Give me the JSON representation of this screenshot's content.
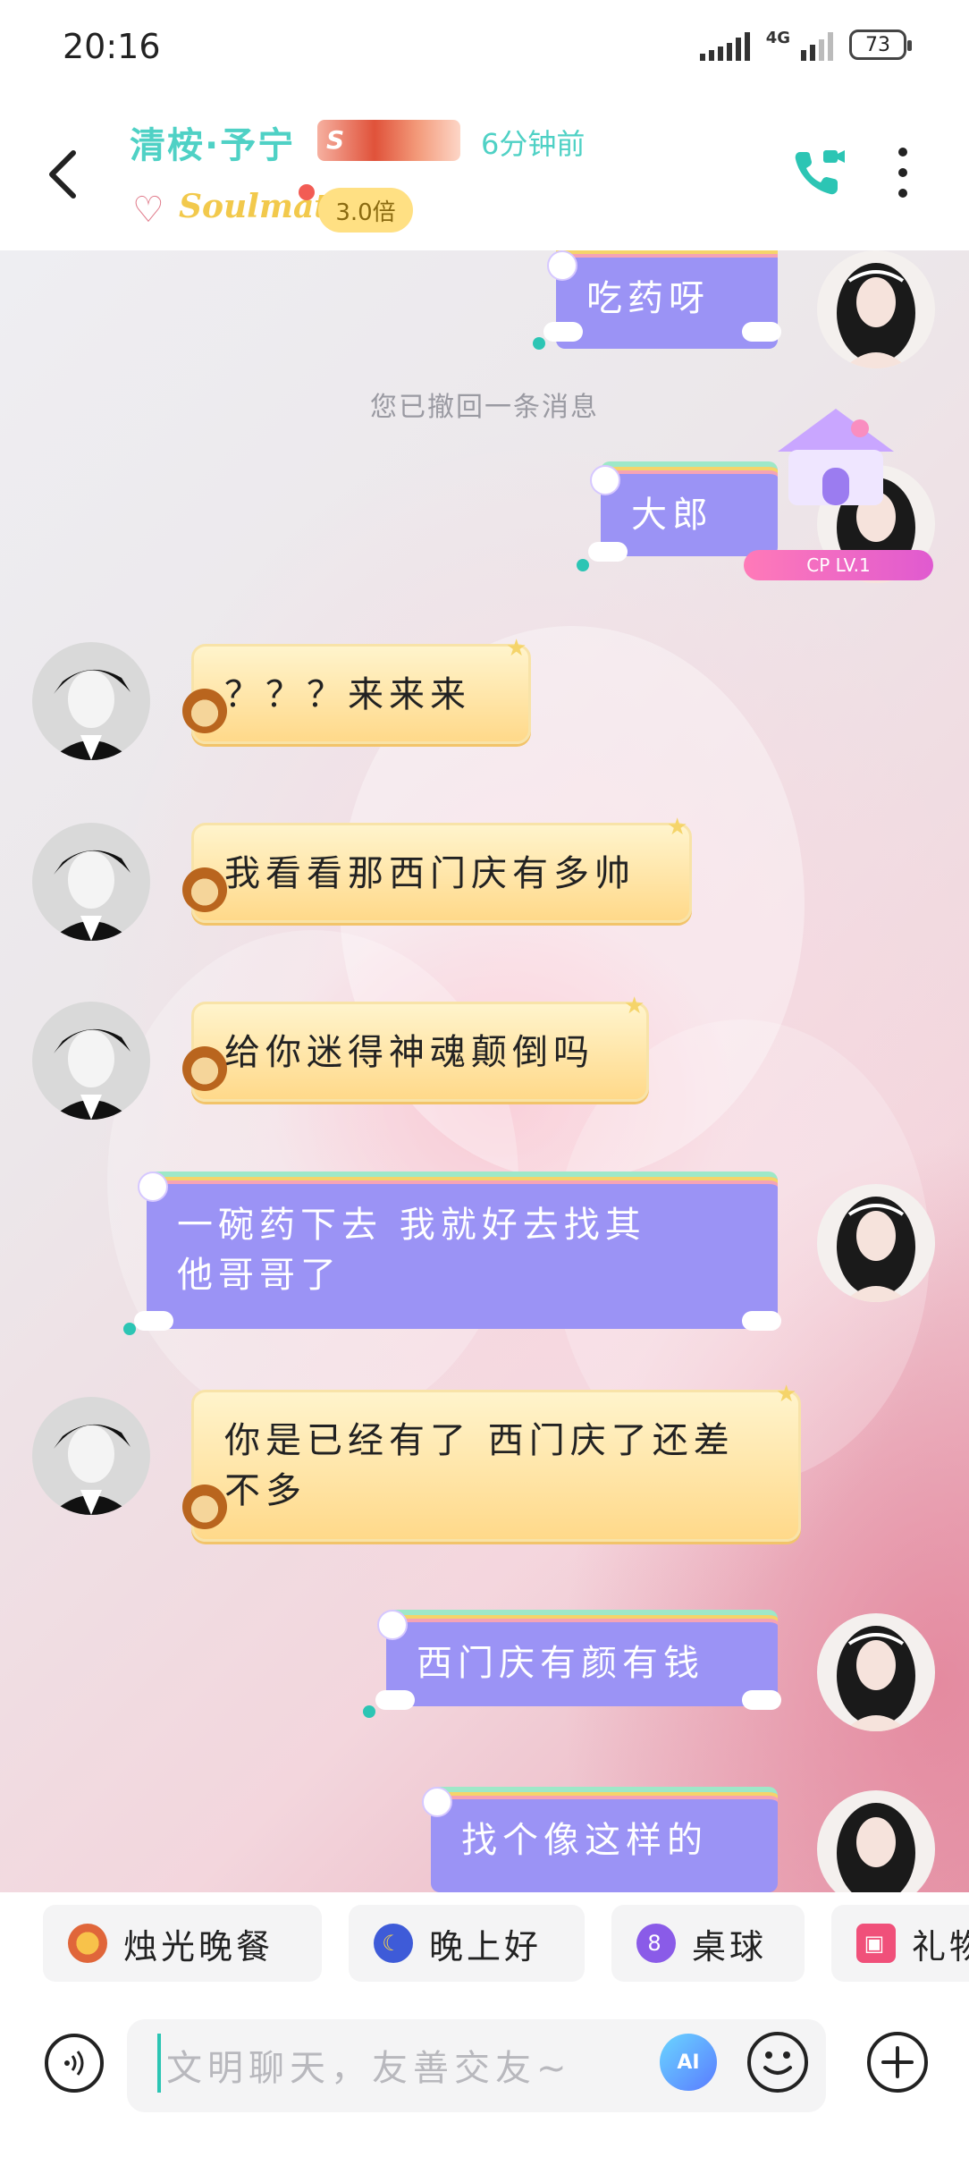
{
  "status_bar": {
    "time": "20:16",
    "network": "4G",
    "battery": "73"
  },
  "header": {
    "contact_name": "清桉·予宁",
    "last_seen": "6分钟前",
    "relationship": "Soulmate",
    "multiplier": "3.0倍"
  },
  "system_message": "您已撤回一条消息",
  "cp_level": "CP LV.1",
  "messages": [
    {
      "side": "me",
      "text": "吃药呀"
    },
    {
      "side": "me",
      "text": "大郎"
    },
    {
      "side": "them",
      "text": "？？？来来来"
    },
    {
      "side": "them",
      "text": "我看看那西门庆有多帅"
    },
    {
      "side": "them",
      "text": "给你迷得神魂颠倒吗"
    },
    {
      "side": "me",
      "line1": "一碗药下去  我就好去找其",
      "line2": "他哥哥了"
    },
    {
      "side": "them",
      "line1": "你是已经有了 西门庆了还差",
      "line2": "不多"
    },
    {
      "side": "me",
      "text": "西门庆有颜有钱"
    },
    {
      "side": "me",
      "text": "找个像这样的"
    }
  ],
  "quick_chips": [
    {
      "label": "烛光晚餐",
      "icon": "candle-dinner-icon"
    },
    {
      "label": "晚上好",
      "icon": "moon-icon"
    },
    {
      "label": "桌球",
      "icon": "billiard-ball-icon"
    },
    {
      "label": "礼物",
      "icon": "gift-icon"
    }
  ],
  "input": {
    "placeholder": "文明聊天，友善交友~",
    "ai_label": "AI"
  },
  "colors": {
    "accent": "#2cc5b4",
    "my_bubble": "#9b93f5",
    "their_bubble": "#ffd98a"
  }
}
